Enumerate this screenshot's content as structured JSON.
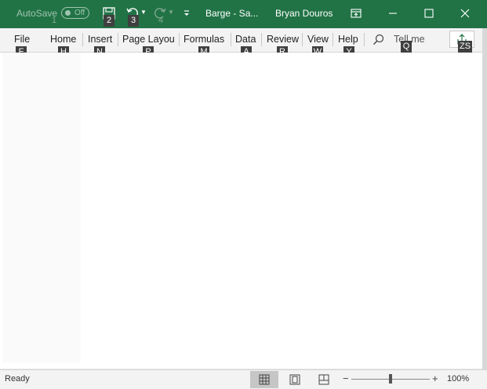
{
  "titlebar": {
    "autosave_label": "AutoSave",
    "autosave_state": "Off",
    "document_title": "Barge  -  Sa...",
    "user_name": "Bryan Douros",
    "accent_color": "#217346"
  },
  "quick_access": {
    "save_icon": "save-icon",
    "undo_icon": "undo-icon",
    "redo_icon": "redo-icon",
    "customize_icon": "customize-caret-icon",
    "keytips": [
      "1",
      "2",
      "3",
      "4"
    ]
  },
  "window_controls": {
    "ribbon_display_icon": "ribbon-display-icon",
    "minimize_icon": "minimize-icon",
    "maximize_icon": "maximize-icon",
    "close_icon": "close-icon"
  },
  "ribbon": {
    "tabs": [
      {
        "label": "File",
        "keytip": "F"
      },
      {
        "label": "Home",
        "keytip": "H"
      },
      {
        "label": "Insert",
        "keytip": "N"
      },
      {
        "label": "Page Layou",
        "keytip": "P"
      },
      {
        "label": "Formulas",
        "keytip": "M"
      },
      {
        "label": "Data",
        "keytip": "A"
      },
      {
        "label": "Review",
        "keytip": "R"
      },
      {
        "label": "View",
        "keytip": "W"
      },
      {
        "label": "Help",
        "keytip": "Y"
      }
    ],
    "tell_me": {
      "label": "Tell me",
      "keytip": "Q",
      "icon": "search-icon"
    },
    "share": {
      "keytip": "ZS",
      "icon": "share-icon"
    }
  },
  "statusbar": {
    "status": "Ready",
    "views": [
      "normal-view-icon",
      "page-layout-view-icon",
      "page-break-preview-icon"
    ],
    "zoom_minus": "−",
    "zoom_plus": "+",
    "zoom_fraction": 0.5,
    "zoom_label": "100%"
  }
}
